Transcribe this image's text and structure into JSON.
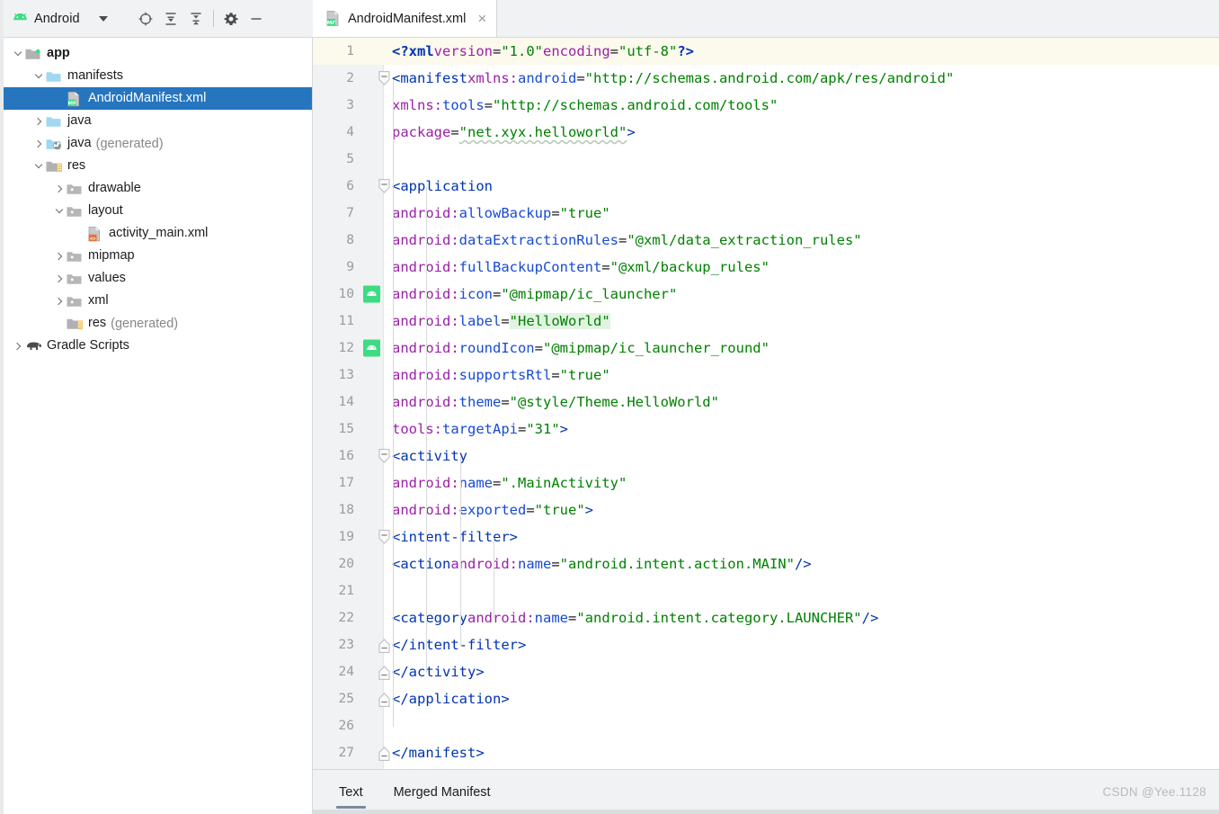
{
  "window": {
    "project_panel_title": "Android",
    "watermark": "CSDN @Yee.1128"
  },
  "toolbar": {
    "dropdown_label": "Android",
    "buttons": [
      {
        "name": "select-opened-file-icon",
        "tooltip": "Select Opened File"
      },
      {
        "name": "expand-all-icon",
        "tooltip": "Expand All"
      },
      {
        "name": "collapse-all-icon",
        "tooltip": "Collapse All"
      },
      {
        "name": "settings-gear-icon",
        "tooltip": "Settings"
      },
      {
        "name": "hide-icon",
        "tooltip": "Hide"
      }
    ]
  },
  "tree": [
    {
      "label": "app",
      "indent": 0,
      "arrow": "down",
      "icon": "module-folder",
      "bold": true,
      "selected": false,
      "suffix": ""
    },
    {
      "label": "manifests",
      "indent": 1,
      "arrow": "down",
      "icon": "folder-blue",
      "bold": false,
      "selected": false,
      "suffix": ""
    },
    {
      "label": "AndroidManifest.xml",
      "indent": 2,
      "arrow": "none",
      "icon": "manifest-file",
      "bold": false,
      "selected": true,
      "suffix": ""
    },
    {
      "label": "java",
      "indent": 1,
      "arrow": "right",
      "icon": "folder-blue",
      "bold": false,
      "selected": false,
      "suffix": ""
    },
    {
      "label": "java",
      "indent": 1,
      "arrow": "right",
      "icon": "folder-generated",
      "bold": false,
      "selected": false,
      "suffix": "(generated)"
    },
    {
      "label": "res",
      "indent": 1,
      "arrow": "down",
      "icon": "folder-res",
      "bold": false,
      "selected": false,
      "suffix": ""
    },
    {
      "label": "drawable",
      "indent": 2,
      "arrow": "right",
      "icon": "folder-gray",
      "bold": false,
      "selected": false,
      "suffix": ""
    },
    {
      "label": "layout",
      "indent": 2,
      "arrow": "down",
      "icon": "folder-gray",
      "bold": false,
      "selected": false,
      "suffix": ""
    },
    {
      "label": "activity_main.xml",
      "indent": 3,
      "arrow": "none",
      "icon": "layout-file",
      "bold": false,
      "selected": false,
      "suffix": ""
    },
    {
      "label": "mipmap",
      "indent": 2,
      "arrow": "right",
      "icon": "folder-gray",
      "bold": false,
      "selected": false,
      "suffix": ""
    },
    {
      "label": "values",
      "indent": 2,
      "arrow": "right",
      "icon": "folder-gray",
      "bold": false,
      "selected": false,
      "suffix": ""
    },
    {
      "label": "xml",
      "indent": 2,
      "arrow": "right",
      "icon": "folder-gray",
      "bold": false,
      "selected": false,
      "suffix": ""
    },
    {
      "label": "res",
      "indent": 2,
      "arrow": "none",
      "icon": "folder-res",
      "bold": false,
      "selected": false,
      "suffix": "(generated)"
    },
    {
      "label": "Gradle Scripts",
      "indent": 0,
      "arrow": "right",
      "icon": "gradle-elephant",
      "bold": false,
      "selected": false,
      "suffix": ""
    }
  ],
  "editor": {
    "tab": {
      "label": "AndroidManifest.xml",
      "icon": "manifest-file",
      "close": "×"
    },
    "file_name": "AndroidManifest.xml",
    "bottom_tabs": [
      {
        "label": "Text",
        "active": true
      },
      {
        "label": "Merged Manifest",
        "active": false
      }
    ],
    "lines": [
      {
        "n": 1,
        "current": true,
        "fold": "none",
        "gutter": "none",
        "text": "<?xml version=\"1.0\" encoding=\"utf-8\"?>"
      },
      {
        "n": 2,
        "current": false,
        "fold": "open",
        "gutter": "none",
        "text": "<manifest xmlns:android=\"http://schemas.android.com/apk/res/android\""
      },
      {
        "n": 3,
        "current": false,
        "fold": "none",
        "gutter": "none",
        "text": "    xmlns:tools=\"http://schemas.android.com/tools\""
      },
      {
        "n": 4,
        "current": false,
        "fold": "none",
        "gutter": "none",
        "text": "    package=\"net.xyx.helloworld\">"
      },
      {
        "n": 5,
        "current": false,
        "fold": "none",
        "gutter": "none",
        "text": ""
      },
      {
        "n": 6,
        "current": false,
        "fold": "open",
        "gutter": "none",
        "text": "    <application"
      },
      {
        "n": 7,
        "current": false,
        "fold": "none",
        "gutter": "none",
        "text": "        android:allowBackup=\"true\""
      },
      {
        "n": 8,
        "current": false,
        "fold": "none",
        "gutter": "none",
        "text": "        android:dataExtractionRules=\"@xml/data_extraction_rules\""
      },
      {
        "n": 9,
        "current": false,
        "fold": "none",
        "gutter": "none",
        "text": "        android:fullBackupContent=\"@xml/backup_rules\""
      },
      {
        "n": 10,
        "current": false,
        "fold": "none",
        "gutter": "android",
        "text": "        android:icon=\"@mipmap/ic_launcher\""
      },
      {
        "n": 11,
        "current": false,
        "fold": "none",
        "gutter": "none",
        "text": "        android:label=\"HelloWorld\""
      },
      {
        "n": 12,
        "current": false,
        "fold": "none",
        "gutter": "android",
        "text": "        android:roundIcon=\"@mipmap/ic_launcher_round\""
      },
      {
        "n": 13,
        "current": false,
        "fold": "none",
        "gutter": "none",
        "text": "        android:supportsRtl=\"true\""
      },
      {
        "n": 14,
        "current": false,
        "fold": "none",
        "gutter": "none",
        "text": "        android:theme=\"@style/Theme.HelloWorld\""
      },
      {
        "n": 15,
        "current": false,
        "fold": "none",
        "gutter": "none",
        "text": "        tools:targetApi=\"31\">"
      },
      {
        "n": 16,
        "current": false,
        "fold": "open",
        "gutter": "none",
        "text": "        <activity"
      },
      {
        "n": 17,
        "current": false,
        "fold": "none",
        "gutter": "none",
        "text": "            android:name=\".MainActivity\""
      },
      {
        "n": 18,
        "current": false,
        "fold": "none",
        "gutter": "none",
        "text": "            android:exported=\"true\">"
      },
      {
        "n": 19,
        "current": false,
        "fold": "open",
        "gutter": "none",
        "text": "            <intent-filter>"
      },
      {
        "n": 20,
        "current": false,
        "fold": "none",
        "gutter": "none",
        "text": "                <action android:name=\"android.intent.action.MAIN\" />"
      },
      {
        "n": 21,
        "current": false,
        "fold": "none",
        "gutter": "none",
        "text": ""
      },
      {
        "n": 22,
        "current": false,
        "fold": "none",
        "gutter": "none",
        "text": "                <category android:name=\"android.intent.category.LAUNCHER\" />"
      },
      {
        "n": 23,
        "current": false,
        "fold": "close",
        "gutter": "none",
        "text": "            </intent-filter>"
      },
      {
        "n": 24,
        "current": false,
        "fold": "close",
        "gutter": "none",
        "text": "        </activity>"
      },
      {
        "n": 25,
        "current": false,
        "fold": "close",
        "gutter": "none",
        "text": "    </application>"
      },
      {
        "n": 26,
        "current": false,
        "fold": "none",
        "gutter": "none",
        "text": ""
      },
      {
        "n": 27,
        "current": false,
        "fold": "close",
        "gutter": "none",
        "text": "</manifest>"
      }
    ]
  },
  "colors": {
    "selection_blue": "#2675bf",
    "tag_blue": "#0033b3",
    "attr_blue": "#174ad4",
    "ns_purple": "#9b20a8",
    "value_green": "#008000",
    "current_line": "#fcf9ed",
    "gutter_bg": "#f1f2f3",
    "panel_bg": "#f1f2f3",
    "android_green": "#3ddc84",
    "highlight_green": "#e2f3e2"
  }
}
